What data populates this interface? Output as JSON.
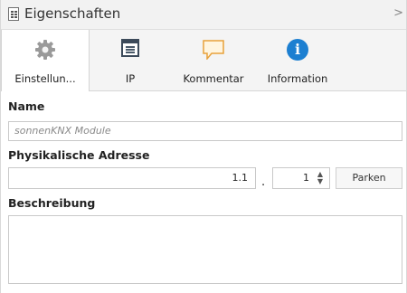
{
  "header": {
    "title": "Eigenschaften",
    "collapse_glyph": ">"
  },
  "tabs": [
    {
      "label": "Einstellun...",
      "icon": "gear-icon"
    },
    {
      "label": "IP",
      "icon": "window-icon"
    },
    {
      "label": "Kommentar",
      "icon": "comment-icon"
    },
    {
      "label": "Information",
      "icon": "info-icon"
    }
  ],
  "info_glyph": "i",
  "form": {
    "name_label": "Name",
    "name_value": "sonnenKNX Module",
    "address_label": "Physikalische Adresse",
    "address_value": "1.1",
    "address_separator": ".",
    "address_device": "1",
    "spinner_up": "▲",
    "spinner_down": "▼",
    "park_button": "Parken",
    "description_label": "Beschreibung",
    "description_value": ""
  },
  "colors": {
    "accent_info": "#1c7fd1",
    "comment_icon": "#e8a13a"
  }
}
